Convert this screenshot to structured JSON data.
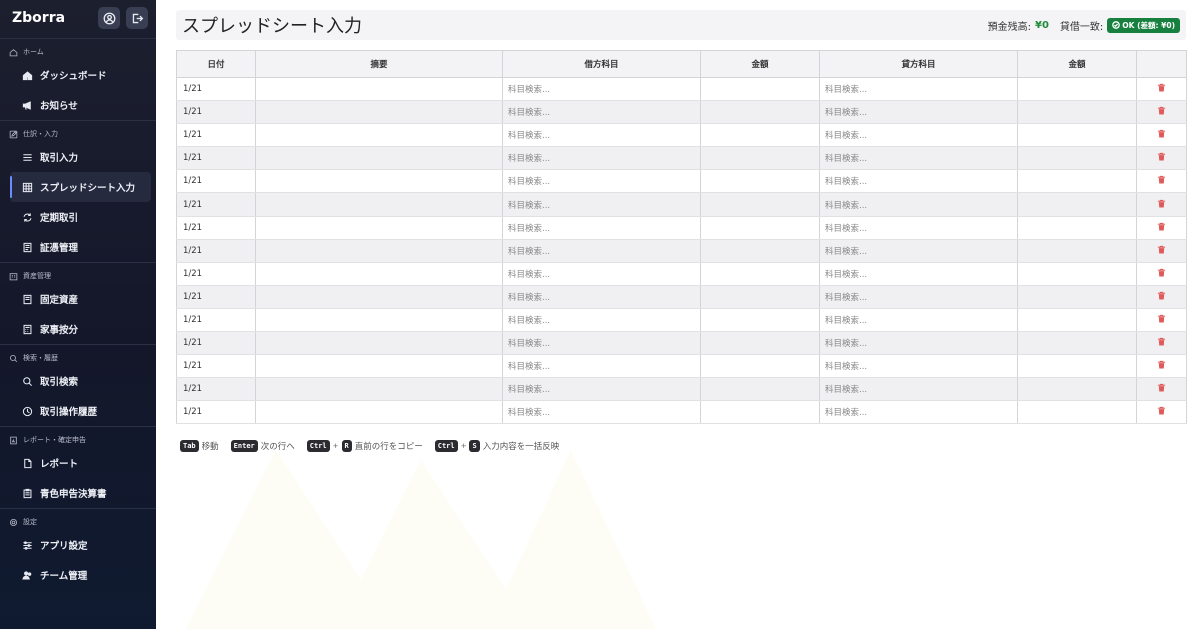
{
  "app": {
    "name": "Zborra"
  },
  "sidebar": {
    "sections": [
      {
        "title": "ホーム",
        "icon": "home-outline-icon",
        "items": [
          {
            "label": "ダッシュボード",
            "icon": "home-icon",
            "active": false
          },
          {
            "label": "お知らせ",
            "icon": "megaphone-icon",
            "active": false
          }
        ]
      },
      {
        "title": "仕訳・入力",
        "icon": "edit-icon",
        "items": [
          {
            "label": "取引入力",
            "icon": "list-icon",
            "active": false
          },
          {
            "label": "スプレッドシート入力",
            "icon": "grid-icon",
            "active": true
          },
          {
            "label": "定期取引",
            "icon": "repeat-icon",
            "active": false
          },
          {
            "label": "証憑管理",
            "icon": "document-icon",
            "active": false
          }
        ]
      },
      {
        "title": "資産管理",
        "icon": "building-icon",
        "items": [
          {
            "label": "固定資産",
            "icon": "book-icon",
            "active": false
          },
          {
            "label": "家事按分",
            "icon": "calculator-icon",
            "active": false
          }
        ]
      },
      {
        "title": "検索・履歴",
        "icon": "search-icon",
        "items": [
          {
            "label": "取引検索",
            "icon": "search-icon",
            "active": false
          },
          {
            "label": "取引操作履歴",
            "icon": "clock-icon",
            "active": false
          }
        ]
      },
      {
        "title": "レポート・確定申告",
        "icon": "report-icon",
        "items": [
          {
            "label": "レポート",
            "icon": "file-icon",
            "active": false
          },
          {
            "label": "青色申告決算書",
            "icon": "clipboard-icon",
            "active": false
          }
        ]
      },
      {
        "title": "設定",
        "icon": "gear-icon",
        "items": [
          {
            "label": "アプリ設定",
            "icon": "sliders-icon",
            "active": false
          },
          {
            "label": "チーム管理",
            "icon": "users-icon",
            "active": false
          }
        ]
      }
    ]
  },
  "header": {
    "title": "スプレッドシート入力",
    "balance_label": "預金残高:",
    "balance_value": "¥0",
    "match_label": "貸借一致:",
    "ok_badge": "OK (差額: ¥0)"
  },
  "table": {
    "columns": [
      "日付",
      "摘要",
      "借方科目",
      "金額",
      "貸方科目",
      "金額",
      ""
    ],
    "rows": [
      {
        "date": "1/21",
        "memo": "",
        "debit_placeholder": "科目検索...",
        "debit_amount": "",
        "credit_placeholder": "科目検索...",
        "credit_amount": ""
      },
      {
        "date": "1/21",
        "memo": "",
        "debit_placeholder": "科目検索...",
        "debit_amount": "",
        "credit_placeholder": "科目検索...",
        "credit_amount": ""
      },
      {
        "date": "1/21",
        "memo": "",
        "debit_placeholder": "科目検索...",
        "debit_amount": "",
        "credit_placeholder": "科目検索...",
        "credit_amount": ""
      },
      {
        "date": "1/21",
        "memo": "",
        "debit_placeholder": "科目検索...",
        "debit_amount": "",
        "credit_placeholder": "科目検索...",
        "credit_amount": ""
      },
      {
        "date": "1/21",
        "memo": "",
        "debit_placeholder": "科目検索...",
        "debit_amount": "",
        "credit_placeholder": "科目検索...",
        "credit_amount": ""
      },
      {
        "date": "1/21",
        "memo": "",
        "debit_placeholder": "科目検索...",
        "debit_amount": "",
        "credit_placeholder": "科目検索...",
        "credit_amount": ""
      },
      {
        "date": "1/21",
        "memo": "",
        "debit_placeholder": "科目検索...",
        "debit_amount": "",
        "credit_placeholder": "科目検索...",
        "credit_amount": ""
      },
      {
        "date": "1/21",
        "memo": "",
        "debit_placeholder": "科目検索...",
        "debit_amount": "",
        "credit_placeholder": "科目検索...",
        "credit_amount": ""
      },
      {
        "date": "1/21",
        "memo": "",
        "debit_placeholder": "科目検索...",
        "debit_amount": "",
        "credit_placeholder": "科目検索...",
        "credit_amount": ""
      },
      {
        "date": "1/21",
        "memo": "",
        "debit_placeholder": "科目検索...",
        "debit_amount": "",
        "credit_placeholder": "科目検索...",
        "credit_amount": ""
      },
      {
        "date": "1/21",
        "memo": "",
        "debit_placeholder": "科目検索...",
        "debit_amount": "",
        "credit_placeholder": "科目検索...",
        "credit_amount": ""
      },
      {
        "date": "1/21",
        "memo": "",
        "debit_placeholder": "科目検索...",
        "debit_amount": "",
        "credit_placeholder": "科目検索...",
        "credit_amount": ""
      },
      {
        "date": "1/21",
        "memo": "",
        "debit_placeholder": "科目検索...",
        "debit_amount": "",
        "credit_placeholder": "科目検索...",
        "credit_amount": ""
      },
      {
        "date": "1/21",
        "memo": "",
        "debit_placeholder": "科目検索...",
        "debit_amount": "",
        "credit_placeholder": "科目検索...",
        "credit_amount": ""
      },
      {
        "date": "1/21",
        "memo": "",
        "debit_placeholder": "科目検索...",
        "debit_amount": "",
        "credit_placeholder": "科目検索...",
        "credit_amount": ""
      }
    ]
  },
  "hints": [
    {
      "keys": [
        "Tab"
      ],
      "text": "移動"
    },
    {
      "keys": [
        "Enter"
      ],
      "text": "次の行へ"
    },
    {
      "keys": [
        "Ctrl",
        "R"
      ],
      "text": "直前の行をコピー"
    },
    {
      "keys": [
        "Ctrl",
        "S"
      ],
      "text": "入力内容を一括反映"
    }
  ],
  "colors": {
    "accent": "#6a8dff",
    "ok": "#17803f",
    "positive": "#1f8a3a",
    "delete": "#e05a5a"
  }
}
